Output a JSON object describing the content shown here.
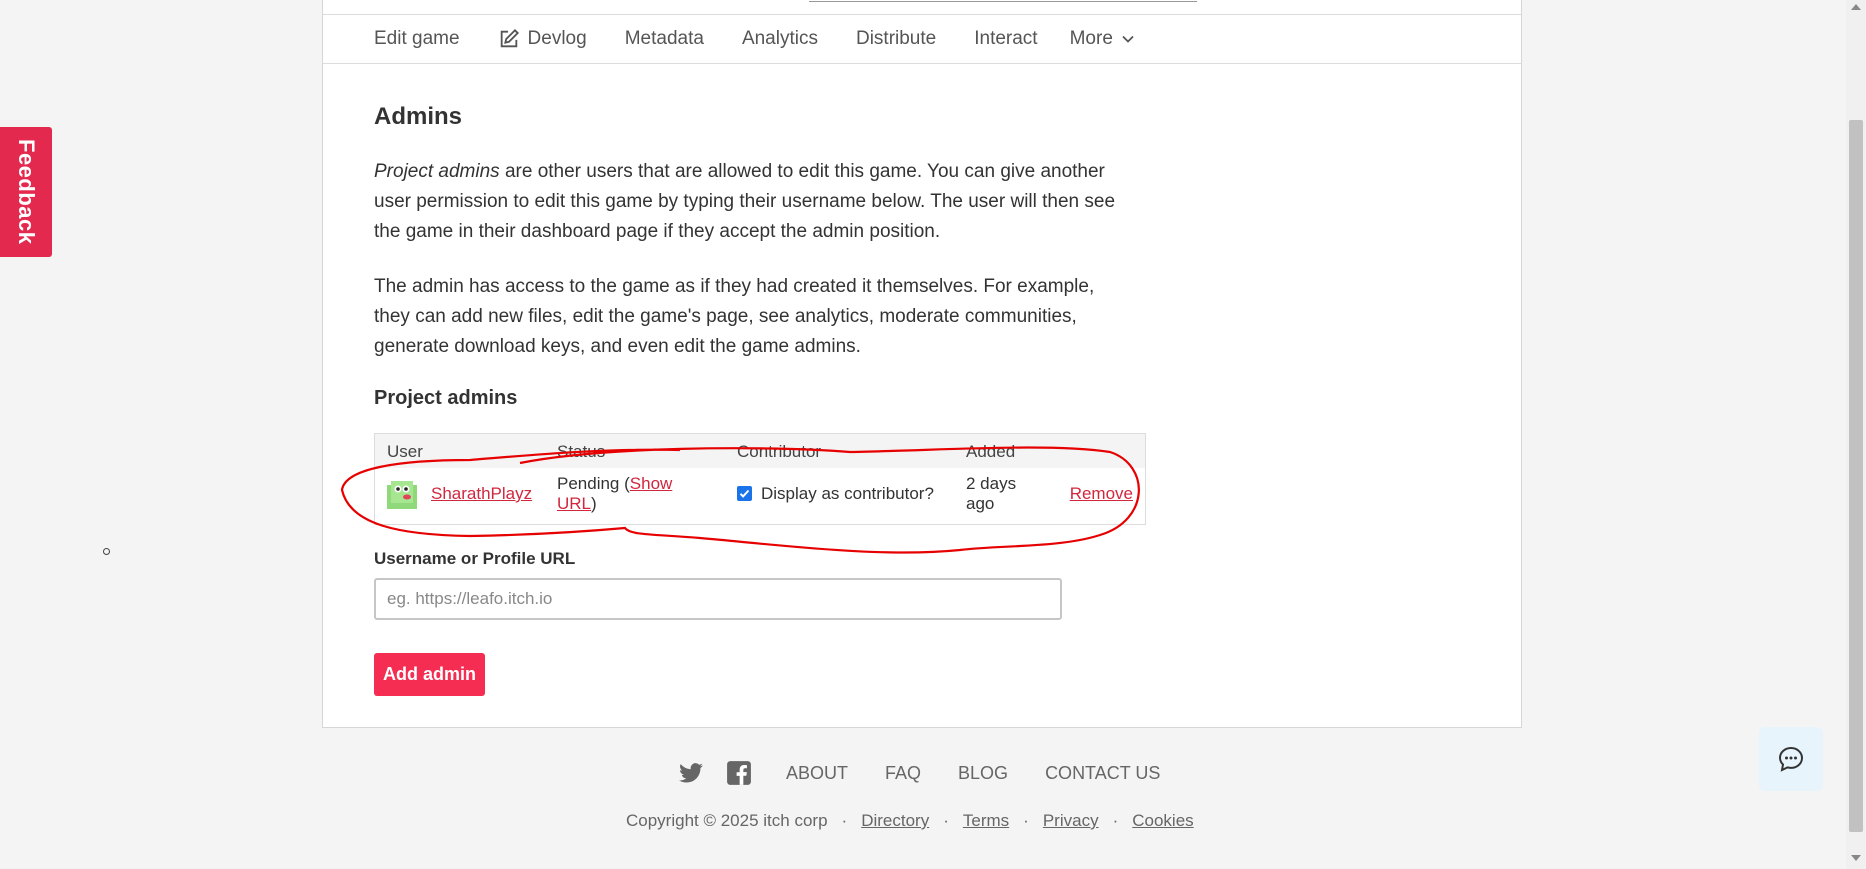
{
  "feedback": {
    "label": "Feedback"
  },
  "nav": {
    "tabs": [
      {
        "label": "Edit game"
      },
      {
        "label": "Devlog"
      },
      {
        "label": "Metadata"
      },
      {
        "label": "Analytics"
      },
      {
        "label": "Distribute"
      },
      {
        "label": "Interact"
      },
      {
        "label": "More"
      }
    ]
  },
  "page": {
    "title": "Admins",
    "intro_italic": "Project admins",
    "intro_rest": " are other users that are allowed to edit this game. You can give another user permission to edit this game by typing their username below. The user will then see the game in their dashboard page if they accept the admin position.",
    "paragraph2": "The admin has access to the game as if they had created it themselves. For example, they can add new files, edit the game's page, see analytics, moderate communities, generate download keys, and even edit the game admins.",
    "section_title": "Project admins"
  },
  "table": {
    "headers": {
      "user": "User",
      "status": "Status",
      "contributor": "Contributor",
      "added": "Added"
    },
    "rows": [
      {
        "username": "SharathPlayz",
        "status_prefix": "Pending (",
        "status_link": "Show URL",
        "status_suffix": ")",
        "contributor_label": "Display as contributor?",
        "contributor_checked": true,
        "added": "2 days ago",
        "remove": "Remove"
      }
    ]
  },
  "form": {
    "label": "Username or Profile URL",
    "placeholder": "eg. https://leafo.itch.io",
    "value": "",
    "submit": "Add admin"
  },
  "footer": {
    "links": [
      "ABOUT",
      "FAQ",
      "BLOG",
      "CONTACT US"
    ],
    "copyright": "Copyright © 2025 itch corp",
    "bottom_links": [
      "Directory",
      "Terms",
      "Privacy",
      "Cookies"
    ],
    "separator": "·"
  },
  "colors": {
    "accent": "#f52d52",
    "link": "#d1273e",
    "annotation": "#e60000",
    "feedback": "#e3294d"
  },
  "icons": [
    "edit-icon",
    "chevron-down-icon",
    "twitter-icon",
    "facebook-icon",
    "chat-icon",
    "avatar"
  ]
}
